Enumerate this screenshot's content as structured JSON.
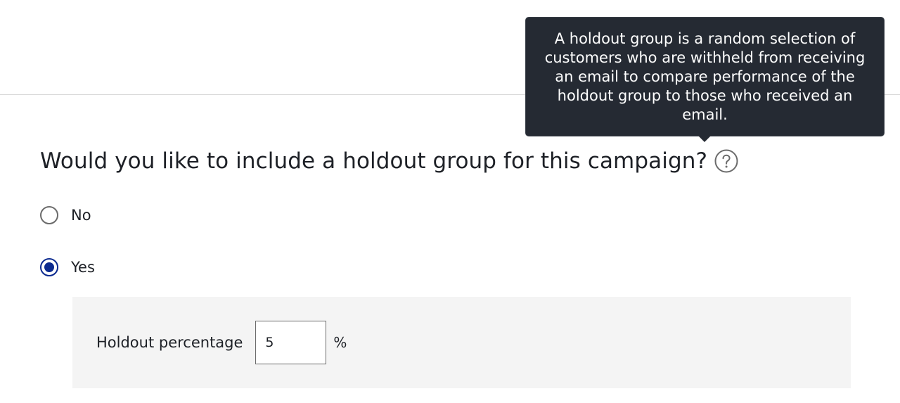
{
  "question": {
    "text": "Would you like to include a holdout group for this campaign?",
    "help_icon": "question-circle-icon"
  },
  "tooltip": {
    "text": "A holdout group is a random selection of customers who are withheld from receiving an email to compare performance of the holdout group to those who received an email."
  },
  "options": [
    {
      "label": "No",
      "selected": false
    },
    {
      "label": "Yes",
      "selected": true
    }
  ],
  "holdout": {
    "label": "Holdout percentage",
    "value": "5",
    "unit": "%"
  },
  "colors": {
    "accent": "#0b2a8f",
    "tooltip_bg": "#252a33",
    "panel_bg": "#f4f4f4",
    "text": "#1d2026"
  }
}
